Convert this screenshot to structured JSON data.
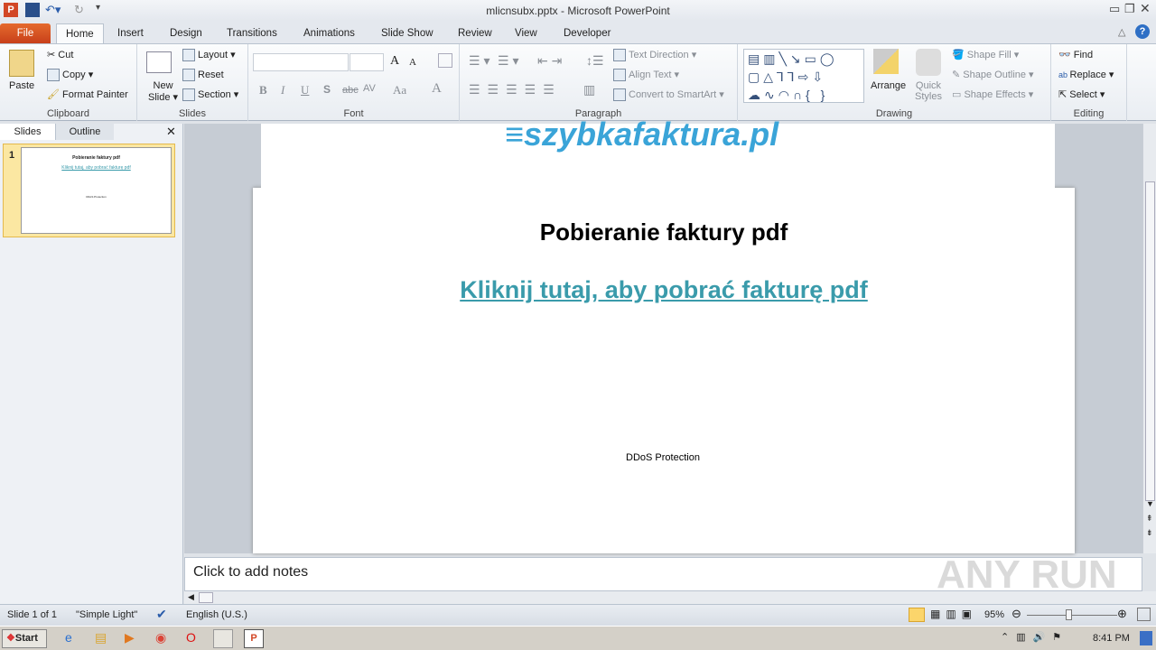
{
  "window": {
    "title": "mlicnsubx.pptx - Microsoft PowerPoint"
  },
  "tabs": [
    "File",
    "Home",
    "Insert",
    "Design",
    "Transitions",
    "Animations",
    "Slide Show",
    "Review",
    "View",
    "Developer"
  ],
  "ribbon": {
    "clipboard": {
      "label": "Clipboard",
      "paste": "Paste",
      "cut": "Cut",
      "copy": "Copy",
      "format_painter": "Format Painter"
    },
    "slides": {
      "label": "Slides",
      "new_slide_1": "New",
      "new_slide_2": "Slide",
      "layout": "Layout",
      "reset": "Reset",
      "section": "Section"
    },
    "font": {
      "label": "Font",
      "font_name": "",
      "font_size": "",
      "bold": "B",
      "italic": "I",
      "underline": "U",
      "shadow": "S",
      "strike": "abc",
      "spacing": "AV",
      "case": "Aa",
      "color": "A",
      "grow": "A",
      "shrink": "A"
    },
    "paragraph": {
      "label": "Paragraph",
      "text_direction": "Text Direction",
      "align_text": "Align Text",
      "smartart": "Convert to SmartArt"
    },
    "drawing": {
      "label": "Drawing",
      "arrange": "Arrange",
      "quick_1": "Quick",
      "quick_2": "Styles",
      "shape_fill": "Shape Fill",
      "shape_outline": "Shape Outline",
      "shape_effects": "Shape Effects"
    },
    "editing": {
      "label": "Editing",
      "find": "Find",
      "replace": "Replace",
      "select": "Select"
    }
  },
  "left_panel": {
    "tab_slides": "Slides",
    "tab_outline": "Outline",
    "slide_number": "1"
  },
  "slide": {
    "logo_text": "szybkafaktura.pl",
    "title": "Pobieranie faktury pdf",
    "link": "Kliknij tutaj, aby pobrać fakturę pdf",
    "footer": "DDoS Protection",
    "link_color": "#3a9bab"
  },
  "notes": {
    "placeholder": "Click to add notes"
  },
  "status": {
    "slide": "Slide 1 of 1",
    "theme": "\"Simple Light\"",
    "language": "English (U.S.)",
    "zoom": "95%",
    "zoom_percent": 95
  },
  "taskbar": {
    "start": "Start",
    "clock": "8:41 PM"
  },
  "watermark": "ANY RUN"
}
